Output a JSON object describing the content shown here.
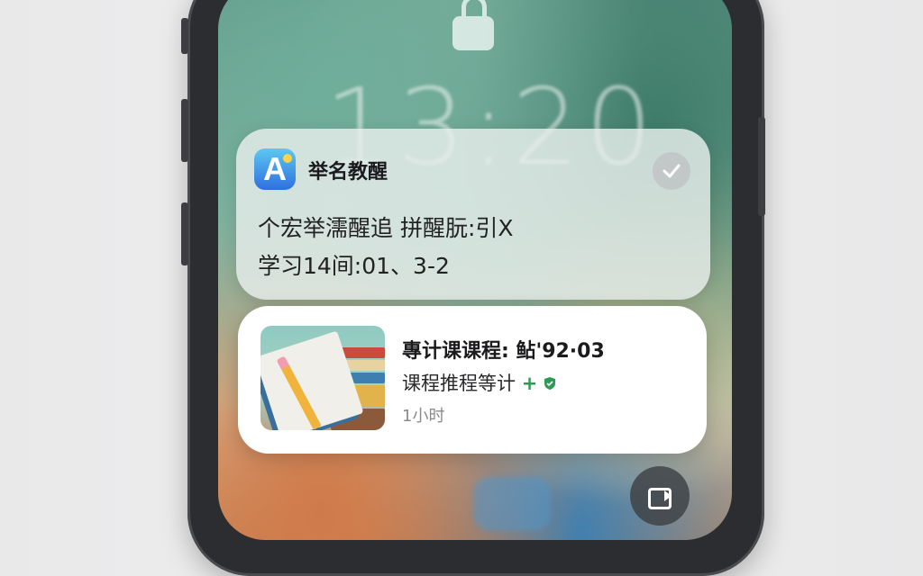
{
  "lock_screen": {
    "time": "13:20"
  },
  "notification_reminder": {
    "app_name": "举名教醒",
    "body_line1": "个宏举濡醒追 拼醒朊:引X",
    "body_line2": "学习14间:01、3-2",
    "icon": "app-store-icon",
    "action_icon": "checkmark-icon"
  },
  "notification_course": {
    "title": "專计课课程: 鲇'92·03",
    "subtitle": "课程推程等计",
    "subtitle_badge": "+",
    "time": "1小时",
    "thumbnail": "books-pencil-image",
    "badge_color": "#2f9a55"
  },
  "controls": {
    "camera_icon": "camera-icon"
  }
}
